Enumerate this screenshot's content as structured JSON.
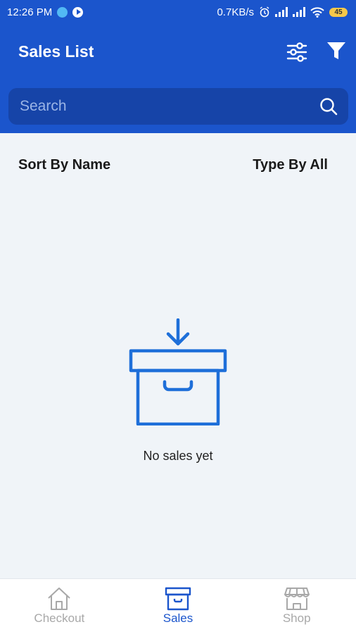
{
  "status_bar": {
    "time": "12:26 PM",
    "network_speed": "0.7KB/s",
    "battery": "45",
    "icons": [
      "app-dot-icon",
      "play-icon",
      "alarm-icon",
      "signal-icon",
      "signal-icon",
      "wifi-icon",
      "battery-icon"
    ]
  },
  "header": {
    "title": "Sales List",
    "icons": [
      "tune-icon",
      "filter-icon"
    ]
  },
  "search": {
    "placeholder": "Search",
    "value": ""
  },
  "sort_bar": {
    "sort_label": "Sort By Name",
    "type_label": "Type By All"
  },
  "empty_state": {
    "message": "No sales yet",
    "icon": "archive-box-icon"
  },
  "bottom_nav": {
    "items": [
      {
        "label": "Checkout",
        "icon": "home-icon",
        "active": false
      },
      {
        "label": "Sales",
        "icon": "archive-box-icon",
        "active": true
      },
      {
        "label": "Shop",
        "icon": "store-icon",
        "active": false
      }
    ]
  },
  "colors": {
    "primary": "#1b55cc",
    "search_bg": "#1644a8",
    "page_bg": "#f0f4f8",
    "icon_blue": "#1e6fd9",
    "inactive": "#a8a8a8"
  }
}
